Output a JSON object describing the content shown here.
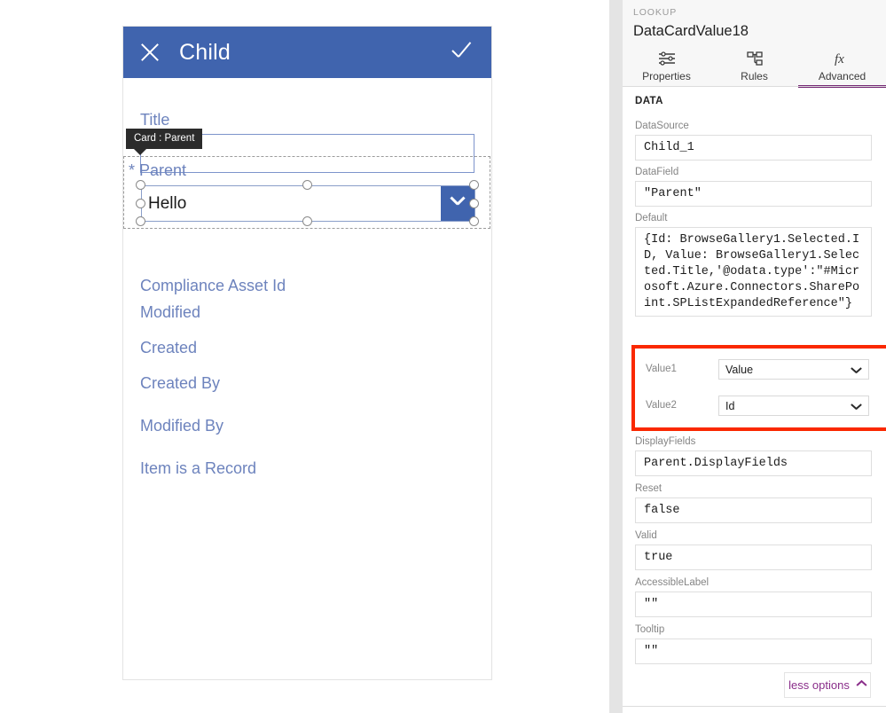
{
  "canvas": {
    "app": {
      "header": {
        "title": "Child",
        "close_icon": "close-x-icon",
        "confirm_icon": "checkmark-icon"
      },
      "fields": [
        {
          "label": "Title",
          "type": "text",
          "value": ""
        },
        {
          "label": "* Parent",
          "type": "combobox",
          "value": "Hello"
        },
        {
          "label": "Compliance Asset Id",
          "type": "label"
        },
        {
          "label": "Modified",
          "type": "label"
        },
        {
          "label": "Created",
          "type": "label"
        },
        {
          "label": "Created By",
          "type": "label"
        },
        {
          "label": "Modified By",
          "type": "label"
        },
        {
          "label": "Item is a Record",
          "type": "label"
        }
      ]
    },
    "tooltip": {
      "text": "Card : Parent"
    },
    "colors": {
      "app_header_bg": "#4064ae",
      "field_label": "#6d83bd",
      "selection_border": "#9b9b9b",
      "tooltip_bg": "#2b2b2b"
    }
  },
  "panel": {
    "kicker": "LOOKUP",
    "control_name": "DataCardValue18",
    "tabs": [
      {
        "label": "Properties",
        "icon": "sliders-icon",
        "active": false
      },
      {
        "label": "Rules",
        "icon": "hierarchy-icon",
        "active": false
      },
      {
        "label": "Advanced",
        "icon": "fx-icon",
        "active": true
      }
    ],
    "section_title": "DATA",
    "properties": [
      {
        "label": "DataSource",
        "value": "Child_1"
      },
      {
        "label": "DataField",
        "value": "\"Parent\""
      },
      {
        "label": "Default",
        "value": "{Id: BrowseGallery1.Selected.ID, Value: BrowseGallery1.Selected.Title,'@odata.type':\"#Microsoft.Azure.Connectors.SharePoint.SPListExpandedReference\"}"
      },
      {
        "label": "DisplayFields",
        "value": "Parent.DisplayFields"
      },
      {
        "label": "Reset",
        "value": "false"
      },
      {
        "label": "Valid",
        "value": "true"
      },
      {
        "label": "AccessibleLabel",
        "value": "\"\""
      },
      {
        "label": "Tooltip",
        "value": "\"\""
      }
    ],
    "highlighted": {
      "selects": [
        {
          "label": "Value1",
          "value": "Value",
          "icon": "chevron-down-icon"
        },
        {
          "label": "Value2",
          "value": "Id",
          "icon": "chevron-down-icon"
        }
      ],
      "highlight_color": "#fa2800"
    },
    "less_options": {
      "label": "less options",
      "icon": "chevron-up-icon"
    },
    "colors": {
      "accent_purple": "#742774",
      "head_bg": "#f7f7f7",
      "gutter": "#e4e4e4"
    }
  }
}
